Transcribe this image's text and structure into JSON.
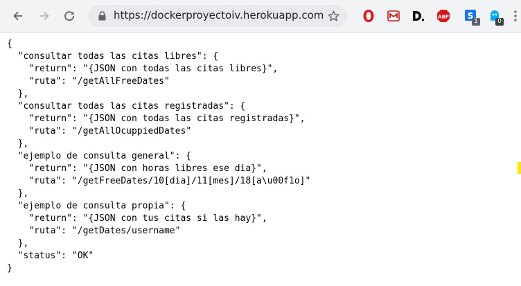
{
  "browser": {
    "url": "https://dockerproyectoiv.herokuapp.com",
    "extensions": [
      {
        "name": "opera-icon",
        "badge": ""
      },
      {
        "name": "mcafee-icon",
        "badge": ""
      },
      {
        "name": "d-icon",
        "badge": ""
      },
      {
        "name": "adblock-plus-icon",
        "badge": ""
      },
      {
        "name": "s-icon",
        "badge": "1"
      },
      {
        "name": "ghostery-icon",
        "badge": "0"
      }
    ]
  },
  "content": {
    "lines": [
      "{",
      "  \"consultar todas las citas libres\": {",
      "    \"return\": \"{JSON con todas las citas libres}\",",
      "    \"ruta\": \"/getAllFreeDates\"",
      "  },",
      "  \"consultar todas las citas registradas\": {",
      "    \"return\": \"{JSON con todas las citas registradas}\",",
      "    \"ruta\": \"/getAllOcuppiedDates\"",
      "  },",
      "  \"ejemplo de consulta general\": {",
      "    \"return\": \"{JSON con horas libres ese dia}\",",
      "    \"ruta\": \"/getFreeDates/10[dia]/11[mes]/18[a\\u00f1o]\"",
      "  },",
      "  \"ejemplo de consulta propia\": {",
      "    \"return\": \"{JSON con tus citas si las hay}\",",
      "    \"ruta\": \"/getDates/username\"",
      "  },",
      "  \"status\": \"OK\"",
      "}"
    ]
  }
}
